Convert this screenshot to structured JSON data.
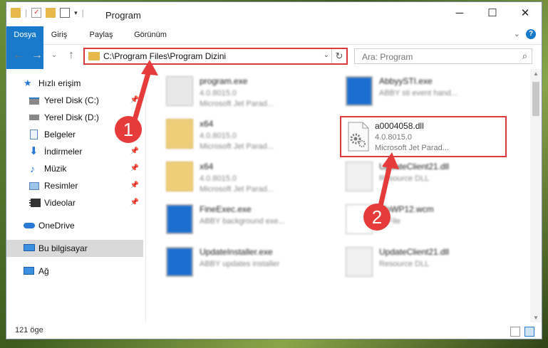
{
  "window": {
    "title": "Program"
  },
  "ribbon": {
    "tabs": [
      "Dosya",
      "Giriş",
      "Paylaş",
      "Görünüm"
    ],
    "help": "?"
  },
  "address": {
    "path": "C:\\Program Files\\Program Dizini"
  },
  "search": {
    "placeholder": "Ara: Program"
  },
  "sidebar": {
    "items": [
      {
        "label": "Hızlı erişim"
      },
      {
        "label": "Yerel Disk (C:)"
      },
      {
        "label": "Yerel Disk (D:)"
      },
      {
        "label": "Belgeler"
      },
      {
        "label": "İndirmeler"
      },
      {
        "label": "Müzik"
      },
      {
        "label": "Resimler"
      },
      {
        "label": "Videolar"
      },
      {
        "label": "OneDrive"
      },
      {
        "label": "Bu bilgisayar"
      },
      {
        "label": "Ağ"
      }
    ]
  },
  "files": [
    {
      "name": "program.exe",
      "line2": "4.0.8015.0",
      "line3": "Microsoft Jet Parad...",
      "icon": "exe-icon"
    },
    {
      "name": "AbbyySTI.exe",
      "line2": "ABBY sti event hand...",
      "line3": "",
      "icon": "app-icon"
    },
    {
      "name": "x64",
      "line2": "4.0.8015.0",
      "line3": "Microsoft Jet Parad...",
      "icon": "folder-icon"
    },
    {
      "name": "x64",
      "line2": "4.0.8015.0",
      "line3": "Microsoft Jet Parad...",
      "icon": "folder-icon"
    },
    {
      "name": "UpdateClient21.dll",
      "line2": "Resource DLL",
      "line3": "",
      "icon": "dll-icon"
    },
    {
      "name": "FineExec.exe",
      "line2": "ABBY background exe...",
      "line3": "",
      "icon": "app-icon"
    },
    {
      "name": "fToWP12.wcm",
      "line2": "M File",
      "line3": "",
      "icon": "file-icon"
    },
    {
      "name": "UpdateInstaller.exe",
      "line2": "ABBY updates installer",
      "line3": "",
      "icon": "app-icon"
    },
    {
      "name": "UpdateClient21.dll",
      "line2": "Resource DLL",
      "line3": "",
      "icon": "dll-icon"
    }
  ],
  "highlighted_file": {
    "name": "a0004058.dll",
    "line2": "4.0.8015.0",
    "line3": "Microsoft Jet Parad...",
    "icon": "gear-dll-icon"
  },
  "annotations": {
    "step1": "1",
    "step2": "2",
    "highlight_color": "#d9393c"
  },
  "status": {
    "count": "121 öge"
  }
}
